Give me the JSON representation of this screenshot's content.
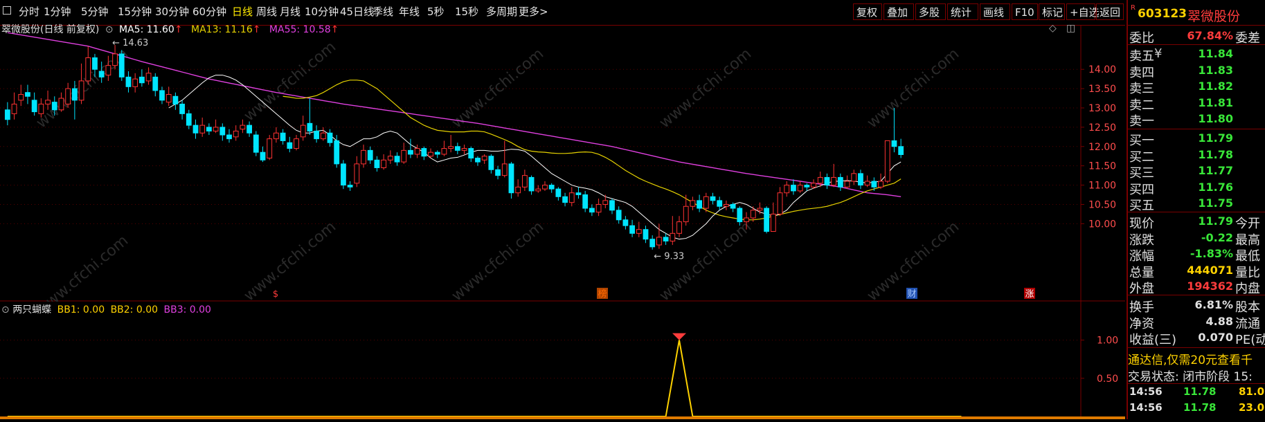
{
  "toolbar": {
    "left_icon": "window-icon",
    "periods": [
      "分时",
      "1分钟",
      "5分钟",
      "15分钟",
      "30分钟",
      "60分钟",
      "日线",
      "周线",
      "月线",
      "10分钟",
      "45日线",
      "季线",
      "年线",
      "5秒",
      "15秒",
      "多周期",
      "更多>"
    ],
    "active_period": "日线",
    "right_buttons": [
      "复权",
      "叠加",
      "多股",
      "统计",
      "画线",
      "F10",
      "标记",
      "+自选",
      "返回"
    ]
  },
  "main_legend": {
    "title": "翠微股份(日线 前复权)",
    "ma5": "MA5: 11.60",
    "ma13": "MA13: 11.16",
    "ma55": "MA55: 10.58",
    "arrow": "↑"
  },
  "sub_legend": {
    "title": "两只蝴蝶",
    "bb1": "BB1: 0.00",
    "bb2": "BB2: 0.00",
    "bb3": "BB3: 0.00"
  },
  "colors": {
    "up": "#ff3333",
    "down": "#00e5ff",
    "ma5": "#ffffff",
    "ma13": "#e6d200",
    "ma55": "#e040e0",
    "axis": "#7a0000",
    "grid": "#5a0000",
    "bb": "#ffd200"
  },
  "annotations": {
    "high": "14.63",
    "low": "9.33",
    "markers": [
      "$",
      "榜",
      "财",
      "涨"
    ]
  },
  "watermark": "www.cfchi.com",
  "right_panel": {
    "badge": "R",
    "code": "603123",
    "name": "翠微股份",
    "weibi_label": "委比",
    "weibi_value": "67.84%",
    "weicha_label": "委差",
    "asks": [
      {
        "label": "卖五",
        "value": "11.84"
      },
      {
        "label": "卖四",
        "value": "11.83"
      },
      {
        "label": "卖三",
        "value": "11.82"
      },
      {
        "label": "卖二",
        "value": "11.81"
      },
      {
        "label": "卖一",
        "value": "11.80"
      }
    ],
    "ask_currency": "¥",
    "bids": [
      {
        "label": "买一",
        "value": "11.79"
      },
      {
        "label": "买二",
        "value": "11.78"
      },
      {
        "label": "买三",
        "value": "11.77"
      },
      {
        "label": "买四",
        "value": "11.76"
      },
      {
        "label": "买五",
        "value": "11.75"
      }
    ],
    "stats": [
      {
        "label": "现价",
        "value": "11.79",
        "label2": "今开",
        "color": "green"
      },
      {
        "label": "涨跌",
        "value": "-0.22",
        "label2": "最高",
        "color": "green"
      },
      {
        "label": "涨幅",
        "value": "-1.83%",
        "label2": "最低",
        "color": "green"
      },
      {
        "label": "总量",
        "value": "444071",
        "label2": "量比",
        "color": "yellow"
      },
      {
        "label": "外盘",
        "value": "194362",
        "label2": "内盘",
        "color": "red"
      }
    ],
    "stats2": [
      {
        "label": "换手",
        "value": "6.81%",
        "label2": "股本"
      },
      {
        "label": "净资",
        "value": "4.88",
        "label2": "流通"
      },
      {
        "label": "收益(三)",
        "value": "0.070",
        "label2": "PE(动)"
      }
    ],
    "promo": "通达信,仅需20元查看千",
    "trade_status": "交易状态: 闭市阶段 15:",
    "ticks": [
      {
        "time": "14:56",
        "price": "11.78",
        "vol": "81.0"
      },
      {
        "time": "14:56",
        "price": "11.78",
        "vol": "23.0"
      }
    ]
  },
  "chart_data": {
    "type": "candlestick",
    "price_axis": [
      10.0,
      10.5,
      11.0,
      11.5,
      12.0,
      12.5,
      13.0,
      13.5,
      14.0
    ],
    "ylim": [
      9.2,
      14.9
    ],
    "candles": [
      [
        12.95,
        12.7,
        13.15,
        12.55
      ],
      [
        12.85,
        13.1,
        13.4,
        12.7
      ],
      [
        13.2,
        13.35,
        13.6,
        13.05
      ],
      [
        13.4,
        13.3,
        13.6,
        13.1
      ],
      [
        13.2,
        12.9,
        13.4,
        12.8
      ],
      [
        12.85,
        13.1,
        13.25,
        12.75
      ],
      [
        13.1,
        13.2,
        13.45,
        12.95
      ],
      [
        13.15,
        12.95,
        13.3,
        12.8
      ],
      [
        12.95,
        13.25,
        13.4,
        12.9
      ],
      [
        13.1,
        13.5,
        13.65,
        13.0
      ],
      [
        13.5,
        13.2,
        13.7,
        12.7
      ],
      [
        13.2,
        13.7,
        14.15,
        13.1
      ],
      [
        13.7,
        14.3,
        14.6,
        13.6
      ],
      [
        14.3,
        14.0,
        14.4,
        13.8
      ],
      [
        13.95,
        13.8,
        14.2,
        13.65
      ],
      [
        13.85,
        14.1,
        14.35,
        13.7
      ],
      [
        14.1,
        14.4,
        14.63,
        14.0
      ],
      [
        14.4,
        13.8,
        14.5,
        13.7
      ],
      [
        13.8,
        13.55,
        13.95,
        13.4
      ],
      [
        13.55,
        13.75,
        13.9,
        13.4
      ],
      [
        13.8,
        13.65,
        14.0,
        13.55
      ],
      [
        13.7,
        13.9,
        14.05,
        13.6
      ],
      [
        13.8,
        13.45,
        13.9,
        13.3
      ],
      [
        13.45,
        13.2,
        13.55,
        13.1
      ],
      [
        13.15,
        13.35,
        13.55,
        13.05
      ],
      [
        13.3,
        13.1,
        13.4,
        12.95
      ],
      [
        13.1,
        12.85,
        13.2,
        12.7
      ],
      [
        12.85,
        12.55,
        12.95,
        12.45
      ],
      [
        12.55,
        12.35,
        12.7,
        12.2
      ],
      [
        12.35,
        12.55,
        12.75,
        12.25
      ],
      [
        12.5,
        12.4,
        12.6,
        12.3
      ],
      [
        12.4,
        12.5,
        12.7,
        12.35
      ],
      [
        12.5,
        12.3,
        12.6,
        12.15
      ],
      [
        12.3,
        12.2,
        12.45,
        12.1
      ],
      [
        12.25,
        12.4,
        12.55,
        12.15
      ],
      [
        12.45,
        12.55,
        12.7,
        12.35
      ],
      [
        12.55,
        12.35,
        12.65,
        12.25
      ],
      [
        12.3,
        11.85,
        12.4,
        11.75
      ],
      [
        11.85,
        11.65,
        12.0,
        11.6
      ],
      [
        11.7,
        12.2,
        12.3,
        11.65
      ],
      [
        12.2,
        12.35,
        12.5,
        12.1
      ],
      [
        12.35,
        12.15,
        12.45,
        12.05
      ],
      [
        12.1,
        11.95,
        12.25,
        11.85
      ],
      [
        11.95,
        12.2,
        12.3,
        11.9
      ],
      [
        12.25,
        12.55,
        12.8,
        12.15
      ],
      [
        12.6,
        12.4,
        13.25,
        12.3
      ],
      [
        12.4,
        12.2,
        12.55,
        12.1
      ],
      [
        12.2,
        12.35,
        12.5,
        12.15
      ],
      [
        12.35,
        12.1,
        12.45,
        12.0
      ],
      [
        12.15,
        11.55,
        12.3,
        11.45
      ],
      [
        11.55,
        11.0,
        11.65,
        10.9
      ],
      [
        11.0,
        10.95,
        11.1,
        10.85
      ],
      [
        11.05,
        11.55,
        11.75,
        10.95
      ],
      [
        11.55,
        11.9,
        12.05,
        11.45
      ],
      [
        11.9,
        11.65,
        12.0,
        11.55
      ],
      [
        11.65,
        11.45,
        11.75,
        11.35
      ],
      [
        11.45,
        11.65,
        11.8,
        11.4
      ],
      [
        11.65,
        11.75,
        11.9,
        11.55
      ],
      [
        11.75,
        11.6,
        11.85,
        11.5
      ],
      [
        11.6,
        11.9,
        12.1,
        11.55
      ],
      [
        11.9,
        11.8,
        12.2,
        11.7
      ],
      [
        11.8,
        11.95,
        12.05,
        11.7
      ],
      [
        11.95,
        11.75,
        12.0,
        11.65
      ],
      [
        11.75,
        11.85,
        11.95,
        11.7
      ],
      [
        11.85,
        11.8,
        11.9,
        11.7
      ],
      [
        11.8,
        11.95,
        12.15,
        11.75
      ],
      [
        11.95,
        12.0,
        12.3,
        11.85
      ],
      [
        12.0,
        11.9,
        12.1,
        11.8
      ],
      [
        11.9,
        11.95,
        12.05,
        11.8
      ],
      [
        11.95,
        11.7,
        12.0,
        11.6
      ],
      [
        11.7,
        11.6,
        11.75,
        11.5
      ],
      [
        11.65,
        11.75,
        11.8,
        11.55
      ],
      [
        11.75,
        11.4,
        11.8,
        11.3
      ],
      [
        11.4,
        11.25,
        11.5,
        11.15
      ],
      [
        11.25,
        11.55,
        12.15,
        11.2
      ],
      [
        11.55,
        10.8,
        11.6,
        10.65
      ],
      [
        10.8,
        10.95,
        11.15,
        10.7
      ],
      [
        10.95,
        11.25,
        11.4,
        10.85
      ],
      [
        11.2,
        10.85,
        11.25,
        10.75
      ],
      [
        10.85,
        10.9,
        11.0,
        10.8
      ],
      [
        10.9,
        11.0,
        11.1,
        10.85
      ],
      [
        11.0,
        10.9,
        11.05,
        10.8
      ],
      [
        10.9,
        10.7,
        10.95,
        10.6
      ],
      [
        10.7,
        10.55,
        10.8,
        10.45
      ],
      [
        10.55,
        10.8,
        10.95,
        10.45
      ],
      [
        10.8,
        10.75,
        10.95,
        10.65
      ],
      [
        10.75,
        10.4,
        10.85,
        10.3
      ],
      [
        10.4,
        10.3,
        10.5,
        10.2
      ],
      [
        10.3,
        10.5,
        10.65,
        10.2
      ],
      [
        10.5,
        10.6,
        10.75,
        10.4
      ],
      [
        10.6,
        10.35,
        10.65,
        10.25
      ],
      [
        10.35,
        10.1,
        10.45,
        10.0
      ],
      [
        10.1,
        9.95,
        10.2,
        9.85
      ],
      [
        9.95,
        9.75,
        10.1,
        9.65
      ],
      [
        9.75,
        9.85,
        10.05,
        9.65
      ],
      [
        9.85,
        9.6,
        9.95,
        9.5
      ],
      [
        9.6,
        9.4,
        9.7,
        9.33
      ],
      [
        9.45,
        9.65,
        10.0,
        9.35
      ],
      [
        9.65,
        9.55,
        9.75,
        9.45
      ],
      [
        9.55,
        9.75,
        10.2,
        9.45
      ],
      [
        9.75,
        10.05,
        10.2,
        9.65
      ],
      [
        10.05,
        10.45,
        10.75,
        9.95
      ],
      [
        10.45,
        10.6,
        10.7,
        10.35
      ],
      [
        10.6,
        10.4,
        10.75,
        10.3
      ],
      [
        10.4,
        10.7,
        10.8,
        10.3
      ],
      [
        10.7,
        10.6,
        10.8,
        10.5
      ],
      [
        10.6,
        10.45,
        10.7,
        10.35
      ],
      [
        10.45,
        10.5,
        10.6,
        10.35
      ],
      [
        10.5,
        10.4,
        10.55,
        10.3
      ],
      [
        10.4,
        10.05,
        10.45,
        9.95
      ],
      [
        10.05,
        10.15,
        10.3,
        9.85
      ],
      [
        10.15,
        10.35,
        10.45,
        10.05
      ],
      [
        10.35,
        10.4,
        10.55,
        10.25
      ],
      [
        10.4,
        9.8,
        10.45,
        9.75
      ],
      [
        9.8,
        10.25,
        10.55,
        9.8
      ],
      [
        10.25,
        10.8,
        10.95,
        10.2
      ],
      [
        10.8,
        11.0,
        11.1,
        10.7
      ],
      [
        11.0,
        10.85,
        11.15,
        10.75
      ],
      [
        10.85,
        11.0,
        11.1,
        10.8
      ],
      [
        11.0,
        10.95,
        11.05,
        10.85
      ],
      [
        10.95,
        11.05,
        11.15,
        10.9
      ],
      [
        11.05,
        11.2,
        11.35,
        10.95
      ],
      [
        11.2,
        11.0,
        11.3,
        10.9
      ],
      [
        11.0,
        11.2,
        11.55,
        10.95
      ],
      [
        11.2,
        10.95,
        11.3,
        10.85
      ],
      [
        10.95,
        11.1,
        11.25,
        10.9
      ],
      [
        11.1,
        11.3,
        11.4,
        11.0
      ],
      [
        11.3,
        11.0,
        11.4,
        10.9
      ],
      [
        11.0,
        11.1,
        11.25,
        10.95
      ],
      [
        11.1,
        10.95,
        11.2,
        10.85
      ],
      [
        10.95,
        11.1,
        11.3,
        10.9
      ],
      [
        11.1,
        12.15,
        12.15,
        11.05
      ],
      [
        12.15,
        12.0,
        13.0,
        11.85
      ],
      [
        12.0,
        11.79,
        12.2,
        11.7
      ]
    ],
    "ma5": [
      13.0,
      13.1,
      13.2,
      13.35,
      13.5,
      13.65,
      13.78,
      13.85,
      13.85,
      13.8,
      13.72,
      13.6,
      13.45,
      13.3,
      13.15,
      13.0,
      12.85,
      12.7,
      12.55,
      12.42,
      12.35,
      12.35,
      12.4,
      12.42,
      12.3,
      12.15,
      12.05,
      12.0,
      12.1,
      12.2,
      12.2,
      12.25,
      12.35,
      12.4,
      12.35,
      12.2,
      12.05,
      11.95,
      11.85,
      11.7,
      11.6,
      11.65,
      11.7,
      11.72,
      11.78,
      11.85,
      11.9,
      11.9,
      11.88,
      11.88,
      11.9,
      11.93,
      11.92,
      11.88,
      11.75,
      11.6,
      11.45,
      11.3,
      11.2,
      11.1,
      11.0,
      10.95,
      10.92,
      10.88,
      10.8,
      10.7,
      10.65,
      10.6,
      10.55,
      10.45,
      10.3,
      10.15,
      10.0,
      9.85,
      9.75,
      9.65,
      9.6,
      9.62,
      9.7,
      9.85,
      10.0,
      10.2,
      10.35,
      10.45,
      10.5,
      10.55,
      10.5,
      10.4,
      10.3,
      10.25,
      10.2,
      10.25,
      10.35,
      10.55,
      10.7,
      10.85,
      10.92,
      10.98,
      11.05,
      11.1,
      11.1,
      11.12,
      11.1,
      11.08,
      11.05,
      11.08,
      11.1,
      11.3,
      11.5,
      11.6
    ],
    "ma13": [
      13.3,
      13.28,
      13.25,
      13.25,
      13.28,
      13.32,
      13.4,
      13.5,
      13.6,
      13.68,
      13.72,
      13.72,
      13.7,
      13.6,
      13.5,
      13.35,
      13.2,
      13.05,
      12.9,
      12.75,
      12.65,
      12.55,
      12.48,
      12.42,
      12.4,
      12.38,
      12.38,
      12.38,
      12.4,
      12.4,
      12.38,
      12.32,
      12.25,
      12.18,
      12.1,
      12.0,
      11.92,
      11.88,
      11.86,
      11.85,
      11.83,
      11.82,
      11.82,
      11.83,
      11.85,
      11.86,
      11.85,
      11.8,
      11.72,
      11.62,
      11.5,
      11.38,
      11.28,
      11.18,
      11.1,
      11.03,
      10.96,
      10.9,
      10.83,
      10.75,
      10.65,
      10.55,
      10.45,
      10.35,
      10.28,
      10.22,
      10.18,
      10.15,
      10.12,
      10.1,
      10.1,
      10.12,
      10.15,
      10.2,
      10.24,
      10.28,
      10.32,
      10.35,
      10.38,
      10.4,
      10.42,
      10.45,
      10.5,
      10.55,
      10.62,
      10.7,
      10.78,
      10.85,
      10.9,
      10.95,
      11.0,
      11.05,
      11.16
    ],
    "ma55_knots": [
      [
        0,
        14.95
      ],
      [
        12,
        14.6
      ],
      [
        20,
        14.2
      ],
      [
        30,
        13.75
      ],
      [
        40,
        13.4
      ],
      [
        50,
        13.1
      ],
      [
        60,
        12.85
      ],
      [
        70,
        12.6
      ],
      [
        80,
        12.3
      ],
      [
        90,
        12.0
      ],
      [
        100,
        11.6
      ],
      [
        110,
        11.3
      ],
      [
        118,
        11.1
      ],
      [
        124,
        10.95
      ],
      [
        128,
        10.8
      ],
      [
        131,
        10.75
      ],
      [
        133,
        10.7
      ],
      [
        137,
        10.62
      ],
      [
        142,
        10.58
      ]
    ],
    "bb_series": {
      "x": [
        0,
        98,
        100,
        102,
        142
      ],
      "y": [
        0.0,
        0.0,
        1.0,
        0.0,
        0.0
      ]
    },
    "sub_axis": [
      0.5,
      1.0
    ]
  }
}
